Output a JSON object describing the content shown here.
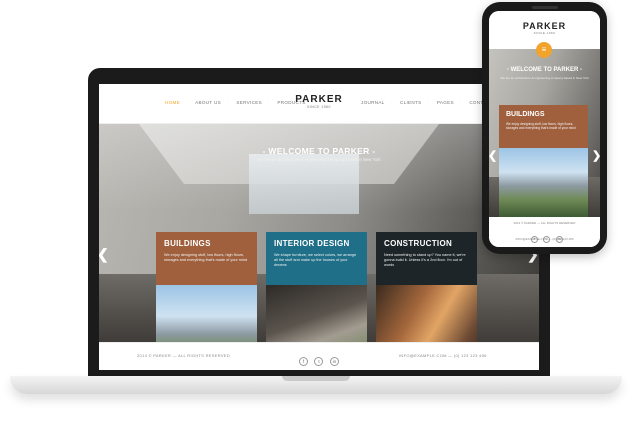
{
  "site": {
    "logo": "PARKER",
    "tagline": "SINCE 1960",
    "nav_left": [
      "HOME",
      "ABOUT US",
      "SERVICES",
      "PRODUCTS"
    ],
    "nav_right": [
      "JOURNAL",
      "CLIENTS",
      "PAGES",
      "CONTACT"
    ],
    "hero_title": "- WELCOME TO PARKER -",
    "hero_subtitle": "We are an architecture & engineering company based in New York",
    "cards": [
      {
        "title": "BUILDINGS",
        "text": "We enjoy designing stuff, low floors, high floors, storages and everything that's made of your mind"
      },
      {
        "title": "INTERIOR DESIGN",
        "text": "We shape furniture, we select colors, we arrange all the stuff and make up the houses of your dreams"
      },
      {
        "title": "CONSTRUCTION",
        "text": "Need something to stand up? You name it, we're gonna build it. Unless it's a 2nd floor. I'm out of words"
      }
    ],
    "footer_copy": "2014 © PARKER — ALL RIGHTS RESERVED",
    "footer_contact": "INFO@EXAMPLE.COM  —  (0) 123 123 456",
    "social": [
      "f",
      "t",
      "in"
    ]
  },
  "mobile": {
    "menu_icon": "≡",
    "card": {
      "title": "BUILDINGS",
      "text": "We enjoy designing stuff, low floors, high floors, storages and everything that's made of your mind"
    },
    "copy": "2014 © PARKER — ALL RIGHTS RESERVED",
    "contact": "INFO@EXAMPLE.COM — (0) 123 123 456"
  },
  "colors": {
    "accent": "#f2a32b",
    "card_buildings": "#a0603e",
    "card_interior": "#1f6f88",
    "card_construction": "#1d2528"
  }
}
